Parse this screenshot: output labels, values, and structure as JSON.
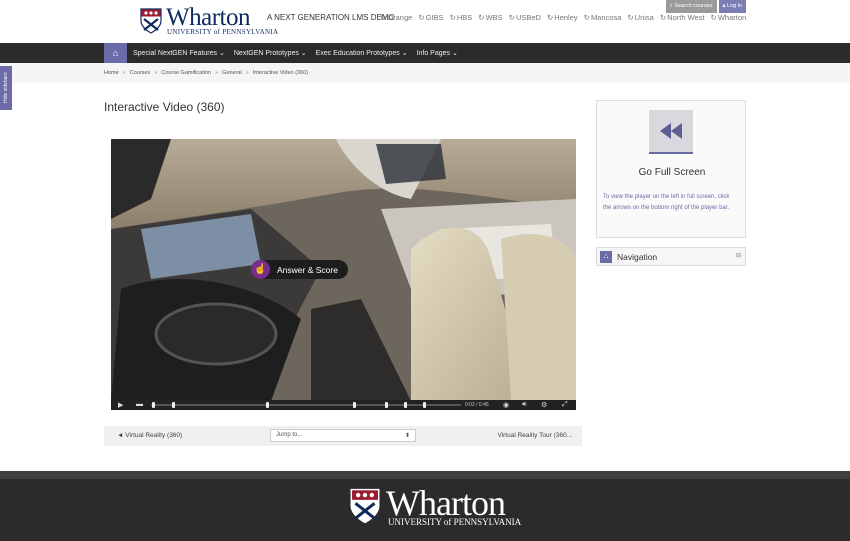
{
  "header": {
    "logo_word": "Wharton",
    "logo_sub": "UNIVERSITY of PENNSYLVANIA",
    "demo_title": "A NEXT GENERATION LMS DEMO",
    "schools": [
      "Orange",
      "GIBS",
      "HBS",
      "WBS",
      "USBeD",
      "Henley",
      "Mancosa",
      "Unisa",
      "North West",
      "Wharton"
    ],
    "search_label": "Search courses",
    "login_label": "Log in"
  },
  "nav": {
    "items": [
      "Special NextGEN Features",
      "NextGEN Prototypes",
      "Exec Education Prototypes",
      "Info Pages"
    ]
  },
  "breadcrumb": [
    "Home",
    "Courses",
    "Course Gamification",
    "General",
    "Interactive Video (360)"
  ],
  "side_tab": "Hide sidebars",
  "page_title": "Interactive Video (360)",
  "video": {
    "hotspot_label": "Answer & Score",
    "time": "0:02 / 0:45",
    "progress": 0.01
  },
  "pager": {
    "prev": "◄ Virtual Reality (360)",
    "jump_placeholder": "Jump to...",
    "next": "Virtual Reality Tour (360..."
  },
  "fullscreen_block": {
    "title": "Go Full Screen",
    "text": "To view the player on the left in full screen, click the arrows on the bottom right of the player bar."
  },
  "navigation_block": {
    "title": "Navigation"
  },
  "footer": {
    "logo_word": "Wharton",
    "logo_sub": "UNIVERSITY of PENNSYLVANIA"
  }
}
